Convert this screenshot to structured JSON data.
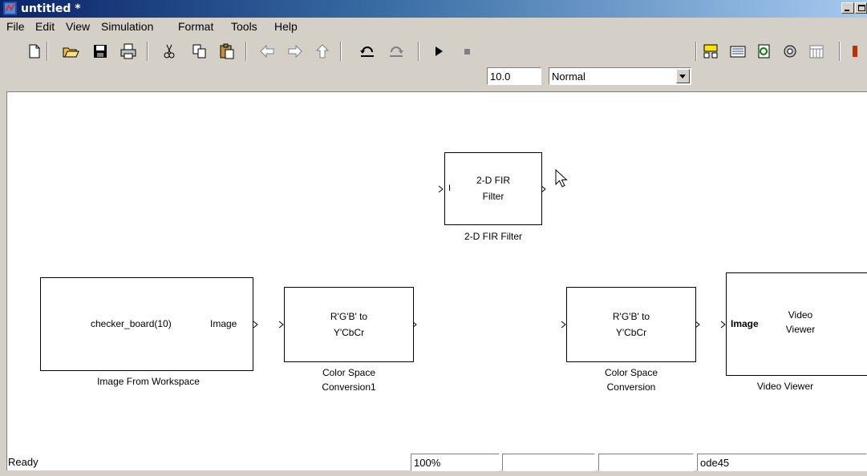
{
  "window": {
    "title": "untitled *"
  },
  "menu": [
    "File",
    "Edit",
    "View",
    "Simulation",
    "Format",
    "Tools",
    "Help"
  ],
  "toolbar": {
    "stop_time": "10.0",
    "sim_mode": "Normal"
  },
  "blocks": {
    "fir_filter": {
      "line1": "2-D FIR",
      "line2": "Filter",
      "in_port": "I",
      "caption": "2-D FIR Filter"
    },
    "image_from_workspace": {
      "text": "checker_board(10)",
      "out_port": "Image",
      "caption": "Image From Workspace"
    },
    "csc1": {
      "line1": "R'G'B' to",
      "line2": "Y'CbCr",
      "caption1": "Color Space",
      "caption2": "Conversion1"
    },
    "csc": {
      "line1": "R'G'B' to",
      "line2": "Y'CbCr",
      "caption1": "Color Space",
      "caption2": "Conversion"
    },
    "video_viewer": {
      "in_port": "Image",
      "line1": "Video",
      "line2": "Viewer",
      "caption": "Video Viewer"
    }
  },
  "status": {
    "state": "Ready",
    "zoom": "100%",
    "solver": "ode45"
  },
  "colors": {
    "titlebar_start": "#0a246a",
    "titlebar_end": "#a6caf0",
    "chrome": "#d4d0c8",
    "canvas": "#ffffff"
  }
}
